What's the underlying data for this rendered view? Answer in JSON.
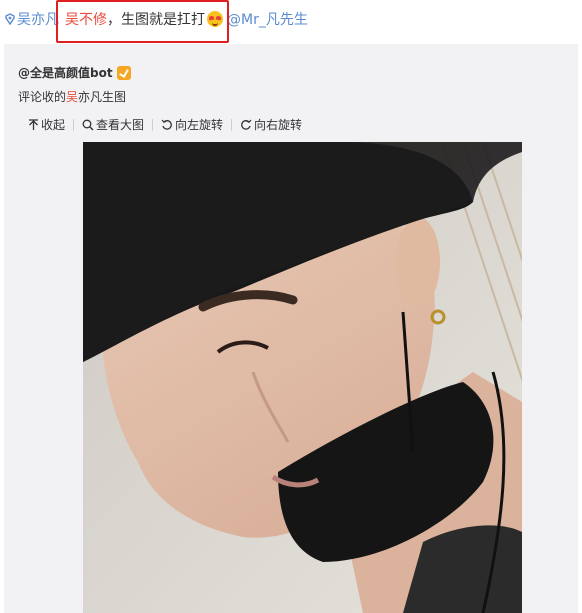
{
  "post": {
    "mention1": "吴亦凡",
    "name_highlight": "吴不修",
    "comma": "，",
    "text": "生图就是扛打",
    "mention2": "@Mr_凡先生"
  },
  "repost": {
    "author": "@全是高颜值bot",
    "caption_prefix": "评论收的",
    "caption_highlight": "吴",
    "caption_suffix": "亦凡生图",
    "toolbar": {
      "collapse": "收起",
      "view_large": "查看大图",
      "rotate_left": "向左旋转",
      "rotate_right": "向右旋转"
    }
  },
  "icons": [
    "super-topic-icon",
    "smile-emoji-icon",
    "verified-badge-icon",
    "collapse-icon",
    "search-icon",
    "rotate-left-icon",
    "rotate-right-icon"
  ],
  "colors": {
    "link": "#5b8bd1",
    "highlight": "#e74c3c",
    "box": "#e02020",
    "card_bg": "#f2f2f5"
  }
}
